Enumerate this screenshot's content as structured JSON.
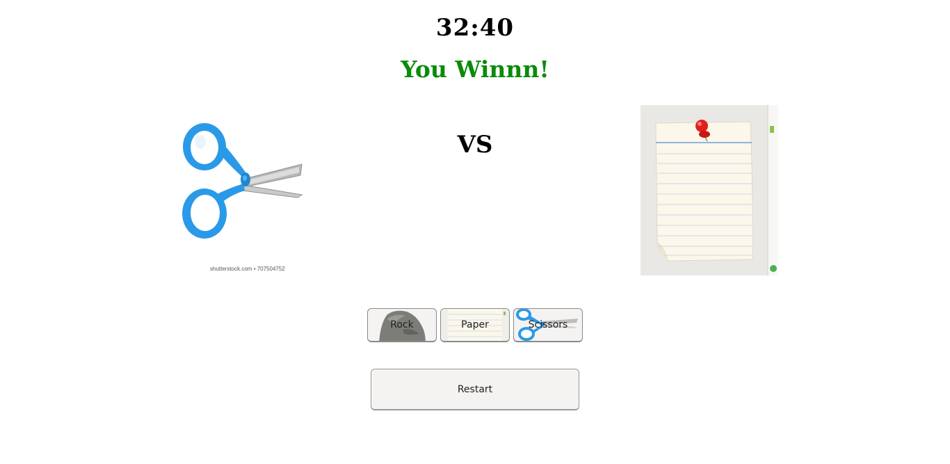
{
  "game": {
    "timer": "32:40",
    "result": "You Winnn!",
    "versus": "VS"
  },
  "player_choice": {
    "icon": "scissors-icon",
    "watermark": "shutterstock.com • 707504752"
  },
  "computer_choice": {
    "icon": "paper-icon"
  },
  "choices": [
    {
      "label": "Rock",
      "icon": "rock-icon"
    },
    {
      "label": "Paper",
      "icon": "paper-icon"
    },
    {
      "label": "Scissors",
      "icon": "scissors-icon"
    }
  ],
  "restart_label": "Restart",
  "colors": {
    "result_text": "#0b8a0b",
    "scissors_handle": "#2a9ae8",
    "pin": "#e0201c"
  }
}
